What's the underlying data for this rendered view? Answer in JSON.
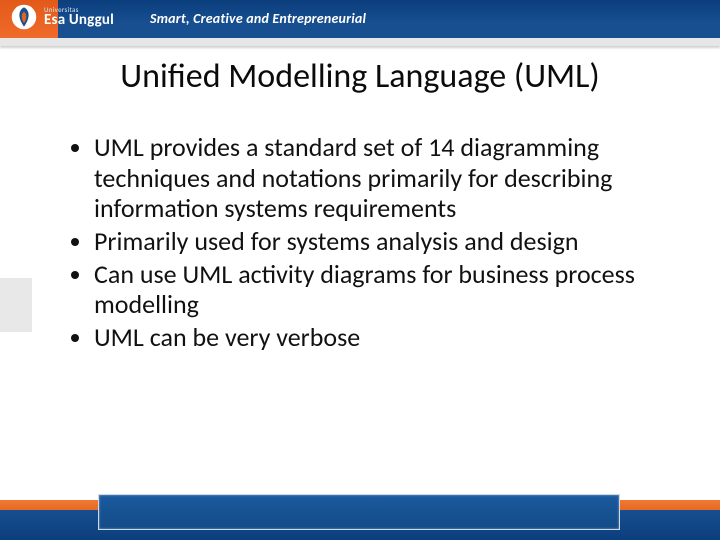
{
  "header": {
    "logo_small": "Universitas",
    "logo_big": "Esa Unggul",
    "tagline": "Smart, Creative and Entrepreneurial"
  },
  "title": "Unified Modelling Language (UML)",
  "bullets": [
    "UML provides a standard set of 14 diagramming techniques and notations primarily for describing information systems requirements",
    "Primarily used for systems analysis and design",
    "Can use UML activity diagrams for business process modelling",
    "UML can be very verbose"
  ]
}
